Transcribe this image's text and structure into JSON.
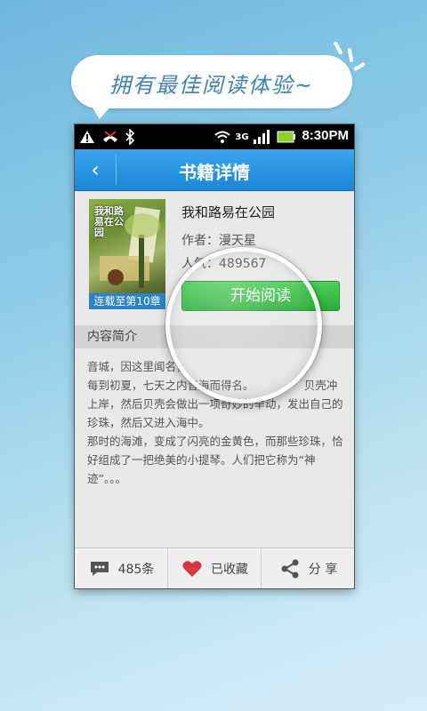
{
  "promo": {
    "slogan": "拥有最佳阅读体验~"
  },
  "status_bar": {
    "time": "8:30PM",
    "icons": [
      "warning-icon",
      "missed-call-icon",
      "bluetooth-icon",
      "wifi-icon",
      "3g-icon",
      "signal-icon",
      "battery-icon"
    ]
  },
  "header": {
    "back_icon": "chevron-left-icon",
    "title": "书籍详情"
  },
  "book": {
    "cover_title": "我和路易在公园",
    "cover_ribbon": "连载至第10章",
    "title": "我和路易在公园",
    "author": "作者：漫天星",
    "popularity": "人气：489567",
    "read_button": "开始阅读"
  },
  "intro": {
    "heading": "内容简介",
    "paragraphs": [
      "音城，因这里闻名，",
      "每到初夏，七天之内音海而得名。　　　　　贝壳冲上岸，然后贝壳会做出一项奇妙的举动，发出自己的珍珠，然后又进入海中。",
      "那时的海滩，变成了闪亮的金黄色，而那些珍珠，恰好组成了一把绝美的小提琴。人们把它称为“神迹”。。。"
    ]
  },
  "bottom_bar": {
    "comments_label": "485条",
    "favorite_label": "已收藏",
    "share_label": "分 享"
  },
  "colors": {
    "accent_blue": "#1a86d6",
    "button_green": "#2aae3a",
    "heart_red": "#d9333f"
  }
}
